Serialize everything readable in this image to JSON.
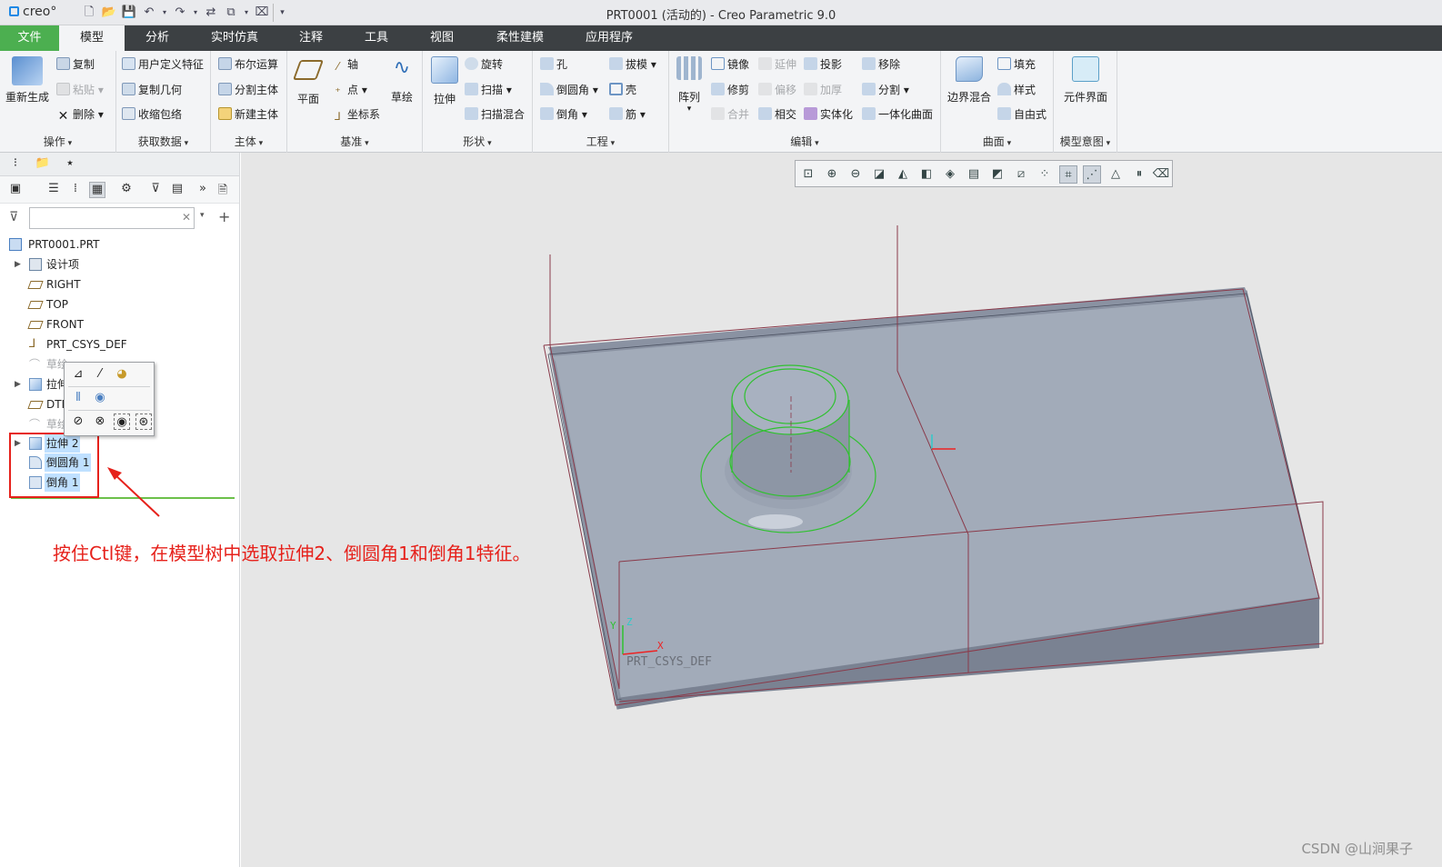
{
  "app": {
    "logo": "creo°",
    "window_title": "PRT0001 (活动的) - Creo Parametric 9.0"
  },
  "tabs": [
    "文件",
    "模型",
    "分析",
    "实时仿真",
    "注释",
    "工具",
    "视图",
    "柔性建模",
    "应用程序"
  ],
  "ribbon": {
    "operations": {
      "label": "操作",
      "regen": "重新生成",
      "copy": "复制",
      "paste": "粘贴",
      "delete": "删除"
    },
    "get_data": {
      "label": "获取数据",
      "udf": "用户定义特征",
      "copy_geom": "复制几何",
      "shrinkwrap": "收缩包络"
    },
    "body": {
      "label": "主体",
      "boolean": "布尔运算",
      "split_body": "分割主体",
      "new_body": "新建主体"
    },
    "datum": {
      "label": "基准",
      "plane": "平面",
      "axis": "轴",
      "point": "点",
      "csys": "坐标系",
      "sketch": "草绘"
    },
    "shapes": {
      "label": "形状",
      "extrude": "拉伸",
      "revolve": "旋转",
      "sweep": "扫描",
      "swept_blend": "扫描混合"
    },
    "engineering": {
      "label": "工程",
      "hole": "孔",
      "round": "倒圆角",
      "chamfer": "倒角",
      "draft": "拔模",
      "shell": "壳",
      "rib": "筋"
    },
    "editing": {
      "label": "编辑",
      "pattern": "阵列",
      "mirror": "镜像",
      "trim": "修剪",
      "merge": "合并",
      "extend": "延伸",
      "offset": "偏移",
      "intersect": "相交",
      "project": "投影",
      "thicken": "加厚",
      "solidify": "实体化",
      "remove": "移除",
      "split": "分割",
      "unify": "一体化曲面"
    },
    "surfaces": {
      "label": "曲面",
      "boundary_blend": "边界混合",
      "fill": "填充",
      "style": "样式",
      "freestyle": "自由式"
    },
    "intent": {
      "label": "模型意图",
      "component_interface": "元件界面"
    }
  },
  "model_tree": {
    "filter_placeholder": "",
    "items": [
      {
        "label": "PRT0001.PRT",
        "dim": false,
        "sel": false
      },
      {
        "label": "设计项",
        "dim": false,
        "sel": false
      },
      {
        "label": "RIGHT",
        "dim": false,
        "sel": false
      },
      {
        "label": "TOP",
        "dim": false,
        "sel": false
      },
      {
        "label": "FRONT",
        "dim": false,
        "sel": false
      },
      {
        "label": "PRT_CSYS_DEF",
        "dim": false,
        "sel": false
      },
      {
        "label": "草绘",
        "dim": true,
        "sel": false
      },
      {
        "label": "拉伸",
        "dim": false,
        "sel": false
      },
      {
        "label": "DTM",
        "dim": false,
        "sel": false
      },
      {
        "label": "草绘",
        "dim": true,
        "sel": false
      },
      {
        "label": "拉伸 2",
        "dim": false,
        "sel": true
      },
      {
        "label": "倒圆角 1",
        "dim": false,
        "sel": true
      },
      {
        "label": "倒角 1",
        "dim": false,
        "sel": true
      }
    ]
  },
  "viewport": {
    "csys_label": "PRT_CSYS_DEF",
    "axis_x": "X",
    "axis_y": "Y",
    "axis_z": "Z"
  },
  "annotation": "按住Ctl键，在模型树中选取拉伸2、倒圆角1和倒角1特征。",
  "watermark": "CSDN @山涧果子",
  "colors": {
    "accent": "#4caf50",
    "tabbar": "#3c4043",
    "annotation": "#e6211b",
    "selection": "#bfe0ff",
    "model": "#8f98a8"
  }
}
